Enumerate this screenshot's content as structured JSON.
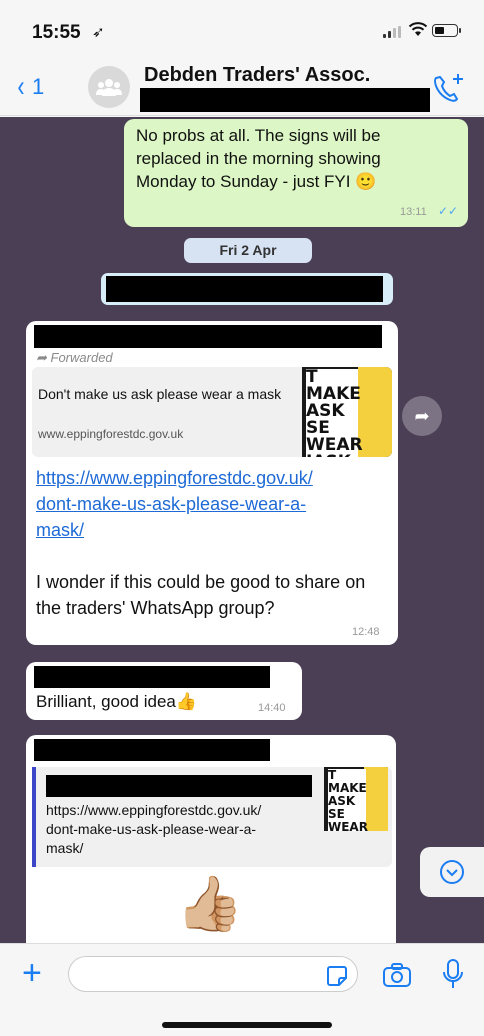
{
  "status": {
    "time": "15:55",
    "location_arrow": "➶"
  },
  "header": {
    "back_chevron": "‹",
    "unread_count": "1",
    "group_title": "Debden Traders' Assoc."
  },
  "messages": {
    "outgoing_1": {
      "text": "No probs at all. The signs will be replaced in the morning showing Monday to Sunday - just FYI 🙂",
      "time": "13:11",
      "ticks": "✓✓"
    },
    "date_separator": "Fri 2 Apr",
    "incoming_1": {
      "forwarded_label": "Forwarded",
      "preview_title": "Don't make us ask please wear a mask",
      "preview_domain": "www.eppingforestdc.gov.uk",
      "thumb_text": "T MAKE ASK SE WEAR IASK",
      "link": "https://www.eppingforestdc.gov.uk/dont-make-us-ask-please-wear-a-mask/",
      "link_lines": [
        "https://www.eppingforestdc.gov.uk/",
        "dont-make-us-ask-please-wear-a-",
        "mask/"
      ],
      "body": "I wonder if this could be good to share on the traders' WhatsApp group?",
      "time": "12:48"
    },
    "incoming_2": {
      "text": "Brilliant, good idea👍",
      "time": "14:40"
    },
    "incoming_3": {
      "quoted_link_lines": [
        "https://www.eppingforestdc.gov.uk/",
        "dont-make-us-ask-please-wear-a-",
        "mask/"
      ],
      "emoji": "👍🏼"
    }
  },
  "input": {
    "plus_label": "+",
    "placeholder": ""
  },
  "colors": {
    "accent": "#1a7df2",
    "chat_bg": "#4a3f55",
    "outgoing_bubble": "#dcf7c5",
    "link": "#1e6ad6"
  },
  "icons": [
    "location-arrow-icon",
    "signal-icon",
    "wifi-icon",
    "battery-icon",
    "group-avatar-icon",
    "add-call-icon",
    "forward-icon",
    "scroll-down-icon",
    "sticker-icon",
    "camera-icon",
    "mic-icon"
  ]
}
